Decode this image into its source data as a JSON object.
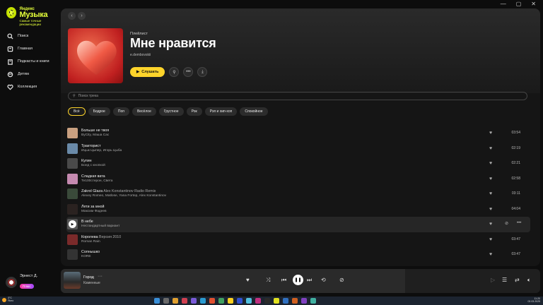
{
  "window": {
    "controls": [
      "—",
      "▢",
      "✕"
    ]
  },
  "brand": {
    "line1": "Яндекс",
    "line2": "Музыка",
    "tagline": "Самые точные рекомендации",
    "color": "#e5ff3a"
  },
  "nav": [
    {
      "label": "Поиск",
      "icon": "search-icon"
    },
    {
      "label": "Главная",
      "icon": "home-icon"
    },
    {
      "label": "Подкасты и книги",
      "icon": "podcast-icon"
    },
    {
      "label": "Детям",
      "icon": "kids-icon"
    },
    {
      "label": "Коллекция",
      "icon": "collection-icon"
    }
  ],
  "user": {
    "name": "Эрнест Д.",
    "badge": "Плюс"
  },
  "playlist": {
    "type_label": "Плейлист",
    "title": "Мне нравится",
    "owner": "e.dembovskii",
    "listen_label": "Слушать"
  },
  "search": {
    "placeholder": "Поиск трека"
  },
  "filters": [
    "Всё",
    "Бодрое",
    "Поп",
    "Весёлое",
    "Грустное",
    "Рок",
    "Рэп и хип-хоп",
    "Спокойное"
  ],
  "accent": "#fed42b",
  "tracks": [
    {
      "title": "Больше не твоя",
      "version": "",
      "artist": "ByCity, Маша Сас",
      "duration": "03:54",
      "thumb": "#c9a080"
    },
    {
      "title": "Тракторист",
      "version": "",
      "artist": "Ицык Цыпер, Игорь Цыба",
      "duration": "02:19",
      "thumb": "#6a8aa8"
    },
    {
      "title": "Кулин",
      "version": "",
      "artist": "Бонд с кнопкой",
      "duration": "02:21",
      "thumb": "#4a4a4a"
    },
    {
      "title": "Сладкая вата",
      "version": "",
      "artist": "Те100стерон, Света",
      "duration": "02:58",
      "thumb": "#c58ab0"
    },
    {
      "title": "Zakrol Glaza",
      "version": "Alex Konstantinov Radio Remix",
      "artist": "Alexey Romeo, Matlose, Yana Fortep, Alex Konstantinov",
      "duration": "03:11",
      "thumb": "#3a4a3a"
    },
    {
      "title": "Лети за мной",
      "version": "",
      "artist": "Максим Фадеев",
      "duration": "04:04",
      "thumb": "#2a2220"
    },
    {
      "title": "В небе",
      "version": "",
      "artist": "Нестандартный вариант",
      "duration": "",
      "thumb": "#555555"
    },
    {
      "title": "Королева",
      "version": "Версия 2010",
      "artist": "Roman Rain",
      "duration": "03:47",
      "thumb": "#7a2a2a"
    },
    {
      "title": "Солнышко",
      "version": "",
      "artist": "KORE",
      "duration": "03:47",
      "thumb": "#333333"
    }
  ],
  "player": {
    "title": "Город",
    "artist": "Каменные"
  },
  "taskbar": {
    "temp": "3°C",
    "weather": "Ясно",
    "time": "11:20",
    "date": "02.03.2025"
  }
}
